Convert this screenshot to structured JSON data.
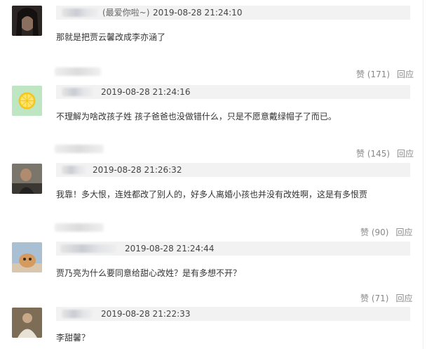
{
  "comments": [
    {
      "suffix": "(最爱你啦~)",
      "timestamp": "2019-08-28 21:24:10",
      "text": "那就是把贾云馨改成李亦涵了",
      "like_label": "赞 (171)",
      "reply_label": "回应"
    },
    {
      "suffix": "",
      "timestamp": "2019-08-28 21:24:16",
      "text": "不理解为啥改孩子姓 孩子爸爸也没做错什么，只是不愿意戴绿帽子了而已。",
      "like_label": "赞 (145)",
      "reply_label": "回应"
    },
    {
      "suffix": "",
      "timestamp": "2019-08-28 21:26:32",
      "text": "我靠！多大恨，连姓都改了别人的，好多人离婚小孩也并没有改姓啊，这是有多恨贾",
      "like_label": "赞 (90)",
      "reply_label": "回应"
    },
    {
      "suffix": "",
      "timestamp": "2019-08-28 21:24:44",
      "text": "贾乃亮为什么要同意给甜心改姓？是有多想不开？",
      "like_label": "赞 (71)",
      "reply_label": "回应"
    },
    {
      "suffix": "",
      "timestamp": "2019-08-28 21:22:33",
      "text": "李甜馨？",
      "like_label": "",
      "reply_label": ""
    }
  ]
}
